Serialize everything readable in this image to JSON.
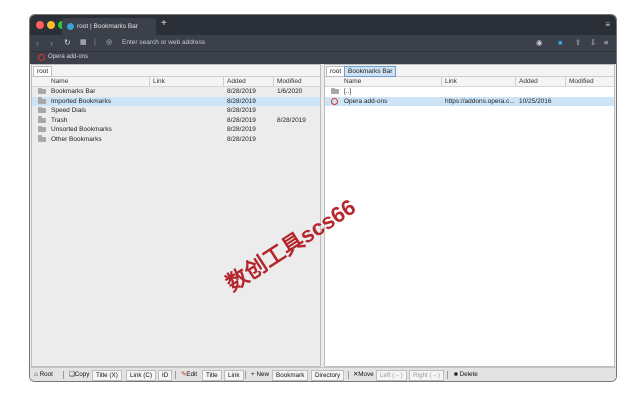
{
  "colors": {
    "titlebar": "#2b2f38",
    "selection": "#cde4f7",
    "accent_red": "#d72b30"
  },
  "browser": {
    "tab_title": "root | Bookmarks Bar",
    "new_tab_symbol": "+",
    "address_placeholder": "Enter search or web address",
    "bookmark_bar_item": "Opera add-ons",
    "icons": [
      "back-icon",
      "forward-icon",
      "reload-icon",
      "grid-icon",
      "shield-icon",
      "camera-icon",
      "wallet-icon",
      "share-icon",
      "download-icon",
      "menu-icon"
    ]
  },
  "left": {
    "breadcrumb": [
      "root"
    ],
    "columns": [
      "Name",
      "Link",
      "Added",
      "Modified"
    ],
    "rows": [
      {
        "name": "Bookmarks Bar",
        "link": "",
        "added": "8/28/2019",
        "modified": "1/6/2020",
        "selected": false
      },
      {
        "name": "Imported Bookmarks",
        "link": "",
        "added": "8/28/2019",
        "modified": "",
        "selected": true
      },
      {
        "name": "Speed Dials",
        "link": "",
        "added": "8/28/2019",
        "modified": "",
        "selected": false
      },
      {
        "name": "Trash",
        "link": "",
        "added": "8/28/2019",
        "modified": "8/28/2019",
        "selected": false
      },
      {
        "name": "Unsorted Bookmarks",
        "link": "",
        "added": "8/28/2019",
        "modified": "",
        "selected": false
      },
      {
        "name": "Other Bookmarks",
        "link": "",
        "added": "8/28/2019",
        "modified": "",
        "selected": false
      }
    ]
  },
  "right": {
    "breadcrumb": [
      "root",
      "Bookmarks Bar"
    ],
    "columns": [
      "Name",
      "Link",
      "Added",
      "Modified"
    ],
    "rows": [
      {
        "name": "[..]",
        "link": "",
        "added": "",
        "modified": "",
        "selected": false,
        "icon": "folder"
      },
      {
        "name": "Opera add-ons",
        "link": "https://addons.opera.c...",
        "added": "10/25/2016",
        "modified": "",
        "selected": true,
        "icon": "opera"
      }
    ]
  },
  "toolbar": {
    "root": "Root",
    "copy": "Copy",
    "title_x": "Title (X)",
    "link_c": "Link (C)",
    "id": "ID",
    "edit": "Edit",
    "title": "Title",
    "link": "Link",
    "new": "New",
    "bookmark": "Bookmark",
    "directory": "Directory",
    "move": "Move",
    "left": "Left (←)",
    "right": "Right (→)",
    "delete": "Delete"
  },
  "watermark": "数创工具scs66"
}
